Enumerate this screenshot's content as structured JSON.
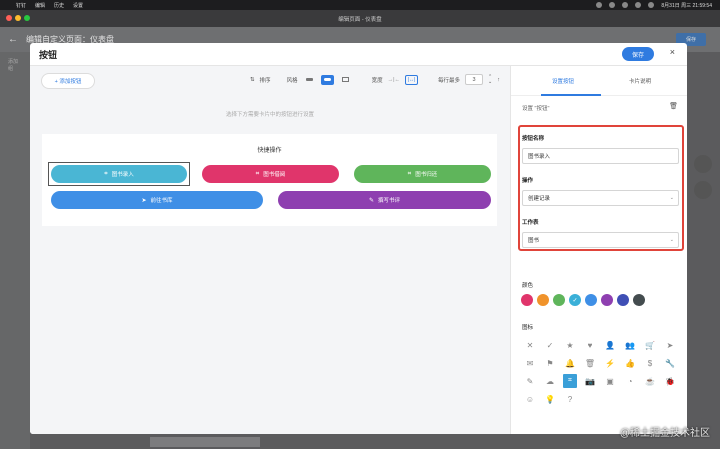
{
  "menubar": {
    "apple": "",
    "items": [
      "钉钉",
      "编辑",
      "历史",
      "设置"
    ],
    "clock": "8月31日 周三 21:59:54"
  },
  "window": {
    "title": "编辑页面 - 仪表盘"
  },
  "background": {
    "header_title": "编辑自定义页面：仪表盘",
    "save_label": "保存",
    "side_items": [
      "添加组",
      "",
      "",
      ""
    ],
    "bottom_text": ""
  },
  "modal": {
    "title": "按钮",
    "save_label": "保存",
    "close": "×",
    "toolbar": {
      "add_button": "+ 添加按钮",
      "sort": "排序",
      "style": "风格",
      "width": "宽度",
      "per_row": "每行最多",
      "per_row_value": "3"
    },
    "hint": "选择下方需要卡片中的按钮进行设置",
    "card": {
      "title": "快捷操作",
      "buttons": [
        {
          "label": "图书录入",
          "icon": "scan-icon",
          "color": "#4ab6d4"
        },
        {
          "label": "图书借阅",
          "icon": "scan-icon",
          "color": "#e0356b"
        },
        {
          "label": "图书归还",
          "icon": "scan-icon",
          "color": "#5fb55b"
        },
        {
          "label": "前往书库",
          "icon": "send-icon",
          "color": "#3f8fe6"
        },
        {
          "label": "撰写书评",
          "icon": "pencil-icon",
          "color": "#8e3fb0"
        }
      ]
    }
  },
  "settings": {
    "tabs": [
      "设置按钮",
      "卡片说明"
    ],
    "section_title": "设置 \"按钮\"",
    "name_label": "按钮名称",
    "name_value": "图书录入",
    "action_label": "操作",
    "action_value": "创建记录",
    "sheet_label": "工作表",
    "sheet_value": "图书",
    "color_label": "颜色",
    "colors": [
      "#e0356b",
      "#f0932b",
      "#5fb55b",
      "#3ab0d8",
      "#3f8fe6",
      "#8e3fb0",
      "#3f4fb5",
      "#444c4f"
    ],
    "selected_color_index": 3,
    "icon_label": "图标",
    "icons": [
      "✕",
      "✓",
      "★",
      "♥",
      "👤",
      "👥",
      "🛒",
      "➤",
      "✉",
      "⚑",
      "🔔",
      "🗑",
      "⚡",
      "👍",
      "$",
      "🔧",
      "✎",
      "☁",
      "⌗",
      "📷",
      "▣",
      "◔",
      "☕",
      "🐞",
      "☺",
      "💡",
      "?"
    ],
    "selected_icon_index": 18
  },
  "watermark": "@稀土掘金技术社区"
}
